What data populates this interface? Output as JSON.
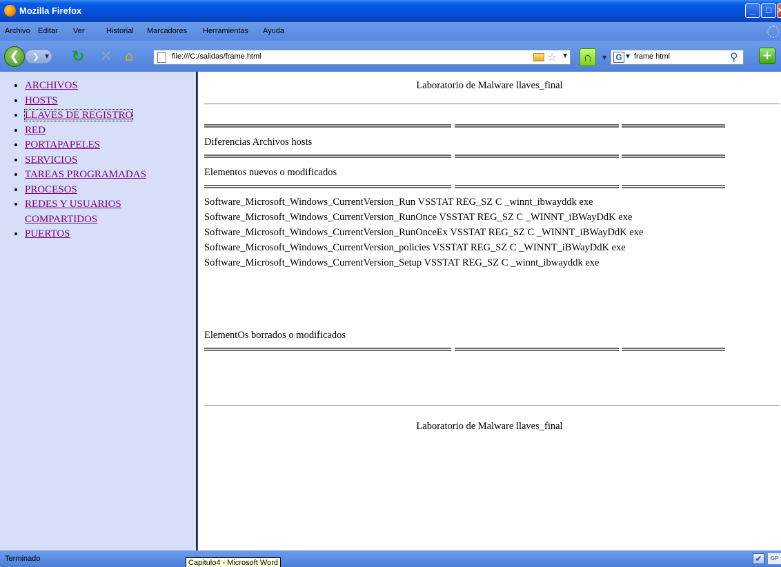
{
  "window": {
    "title": "Mozilla Firefox",
    "min_glyph": "_",
    "max_glyph": "□",
    "close_glyph": "×"
  },
  "menu": {
    "items": [
      "Archivo",
      "Editar",
      "Ver",
      "Historial",
      "Marcadores",
      "Herramientas",
      "Ayuda"
    ]
  },
  "toolbar": {
    "url": "file:///C:/salidas/frame.html",
    "search_query": "frame html",
    "search_engine_letter": "G"
  },
  "sidebar": {
    "links": [
      "ARCHIVOS",
      "HOSTS",
      "LLAVES DE REGISTRO",
      "RED",
      "PORTAPAPELES",
      "SERVICIOS",
      "TAREAS PROGRAMADAS",
      "PROCESOS",
      "REDES Y USUARIOS COMPARTIDOS",
      "PUERTOS"
    ],
    "focused_index": 2
  },
  "main": {
    "header": "Laboratorio de Malware llaves_final",
    "section_hosts": "Diferencias Archivos hosts",
    "section_new": "Elementos nuevos o modificados",
    "entries": [
      "Software_Microsoft_Windows_CurrentVersion_Run VSSTAT REG_SZ C _winnt_ibwayddk exe",
      "Software_Microsoft_Windows_CurrentVersion_RunOnce VSSTAT REG_SZ C _WINNT_iBWayDdK exe",
      "Software_Microsoft_Windows_CurrentVersion_RunOnceEx VSSTAT REG_SZ C _WINNT_iBWayDdK exe",
      "Software_Microsoft_Windows_CurrentVersion_policies VSSTAT REG_SZ C _WINNT_iBWayDdK exe",
      "Software_Microsoft_Windows_CurrentVersion_Setup VSSTAT REG_SZ C _winnt_ibwayddk exe"
    ],
    "section_deleted": "ElementOs borrados o modificados",
    "footer": "Laboratorio de Malware llaves_final"
  },
  "status": {
    "text": "Terminado",
    "tooltip": "Capitulo4 - Microsoft Word"
  },
  "colors": {
    "link_visited": "#800080",
    "sidebar_bg": "#d6dff7",
    "chrome_blue": "#0450d8"
  }
}
